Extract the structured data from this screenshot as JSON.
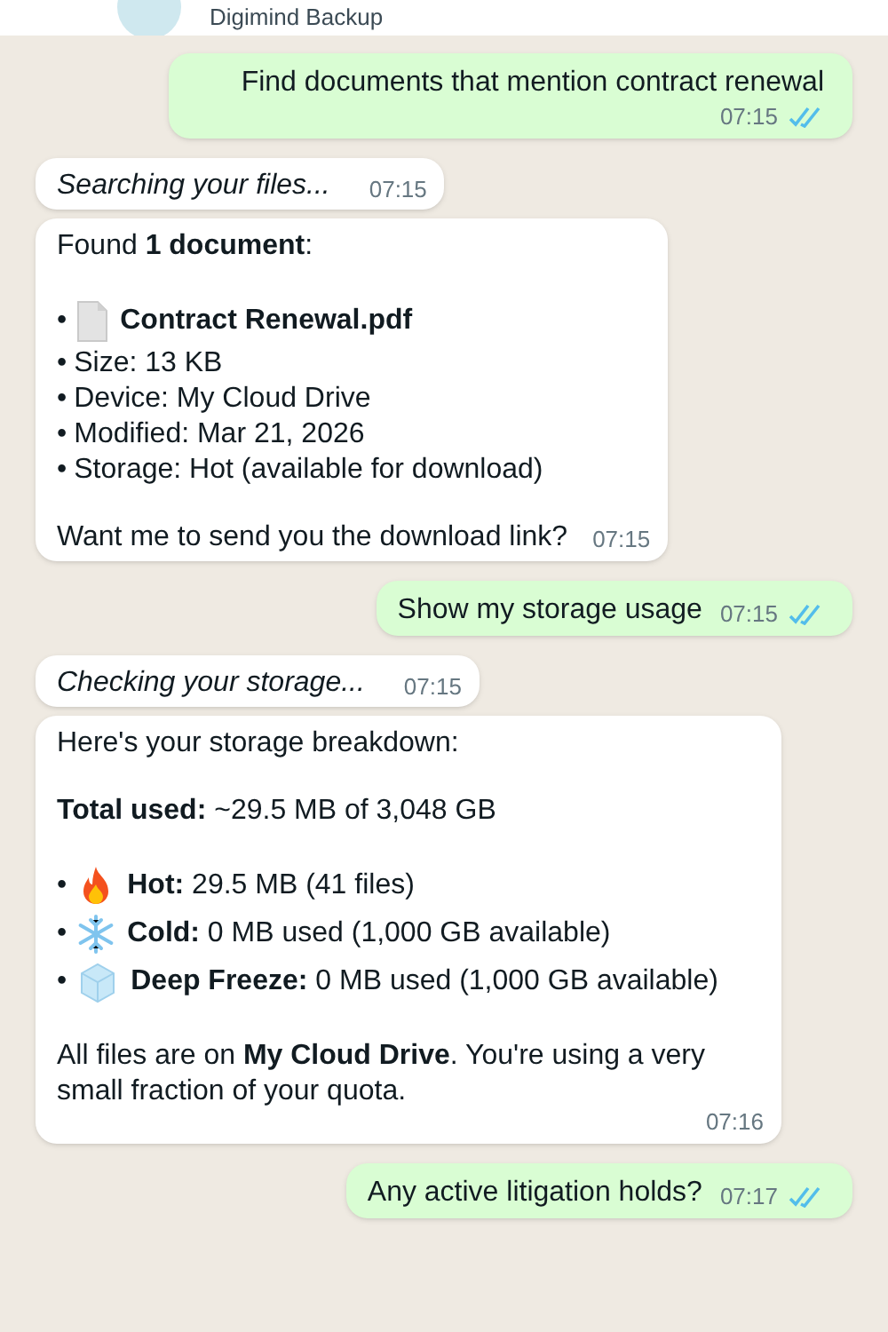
{
  "header": {
    "title": "Digimind Backup"
  },
  "messages": [
    {
      "kind": "sent",
      "text": "Find documents that mention contract renewal",
      "time": "07:15",
      "read": true
    },
    {
      "kind": "status",
      "text": "Searching your files...",
      "time": "07:15"
    },
    {
      "kind": "reply",
      "time": "07:15",
      "blocks": [
        {
          "kind": "para",
          "text": "Found **1 document**:"
        },
        {
          "kind": "list",
          "items": [
            {
              "bullet": "•",
              "kind": "file",
              "text": "**Contract Renewal.pdf**"
            },
            {
              "bullet": "•",
              "text": "Size: 13 KB"
            },
            {
              "bullet": "•",
              "text": "Device: My Cloud Drive"
            },
            {
              "bullet": "•",
              "text": "Modified: Mar 21, 2026"
            },
            {
              "bullet": "•",
              "text": "Storage: Hot (available for download)"
            }
          ]
        },
        {
          "kind": "para",
          "text": "Want me to send you the download link?"
        }
      ]
    },
    {
      "kind": "sent",
      "text": "Show my storage usage",
      "time": "07:15",
      "read": true
    },
    {
      "kind": "status",
      "text": "Checking your storage...",
      "time": "07:15"
    },
    {
      "kind": "reply",
      "time": "07:16",
      "blocks": [
        {
          "kind": "para",
          "text": "Here's your storage breakdown:"
        },
        {
          "kind": "para",
          "text": "**Total used:** ~29.5 MB of 3,048 GB"
        },
        {
          "kind": "list",
          "items": [
            {
              "bullet": "•",
              "kind": "fire",
              "text": "**Hot:** 29.5 MB (41 files)"
            },
            {
              "bullet": "•",
              "kind": "snowflake",
              "text": "**Cold:** 0 MB used (1,000 GB available)"
            },
            {
              "bullet": "•",
              "kind": "ice",
              "text": "**Deep Freeze:** 0 MB used (1,000 GB available)"
            }
          ]
        },
        {
          "kind": "para",
          "text": "All files are on **My Cloud Drive**. You're using a very small fraction of your quota."
        }
      ]
    },
    {
      "kind": "sent",
      "text": "Any active litigation holds?",
      "time": "07:17",
      "read": true
    }
  ]
}
